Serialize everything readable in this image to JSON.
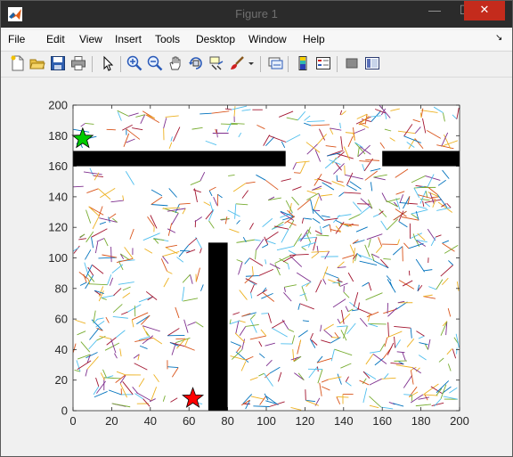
{
  "window": {
    "title": "Figure 1",
    "minimize_label": "—",
    "maximize_label": "☐",
    "close_label": "✕"
  },
  "menu": {
    "items": [
      "File",
      "Edit",
      "View",
      "Insert",
      "Tools",
      "Desktop",
      "Window",
      "Help"
    ],
    "dock_glyph": "↘"
  },
  "toolbar": {
    "buttons": [
      "new-figure-icon",
      "open-file-icon",
      "save-icon",
      "print-icon",
      "edit-plot-icon",
      "zoom-in-icon",
      "zoom-out-icon",
      "pan-icon",
      "rotate-3d-icon",
      "data-cursor-icon",
      "brush-icon",
      "brush-dropdown-icon",
      "link-plot-icon",
      "insert-colorbar-icon",
      "insert-legend-icon",
      "hide-plot-tools-icon",
      "show-plot-tools-icon"
    ]
  },
  "chart_data": {
    "type": "scatter",
    "title": "",
    "xlabel": "",
    "ylabel": "",
    "xlim": [
      0,
      200
    ],
    "ylim": [
      0,
      200
    ],
    "xticks": [
      0,
      20,
      40,
      60,
      80,
      100,
      120,
      140,
      160,
      180,
      200
    ],
    "yticks": [
      0,
      20,
      40,
      60,
      80,
      100,
      120,
      140,
      160,
      180,
      200
    ],
    "grid": false,
    "obstacles": [
      {
        "x": [
          0,
          110
        ],
        "y": [
          160,
          170
        ]
      },
      {
        "x": [
          160,
          200
        ],
        "y": [
          160,
          170
        ]
      },
      {
        "x": [
          70,
          80
        ],
        "y": [
          0,
          110
        ]
      }
    ],
    "markers": [
      {
        "name": "start",
        "shape": "star",
        "color": "#00cc00",
        "x": 5,
        "y": 178
      },
      {
        "name": "goal",
        "shape": "star",
        "color": "#ff0000",
        "x": 62,
        "y": 8
      }
    ],
    "tree_colors": [
      "#0072bd",
      "#d95319",
      "#edb120",
      "#7e2f8e",
      "#77ac30",
      "#4dbeee",
      "#a2142f"
    ]
  }
}
